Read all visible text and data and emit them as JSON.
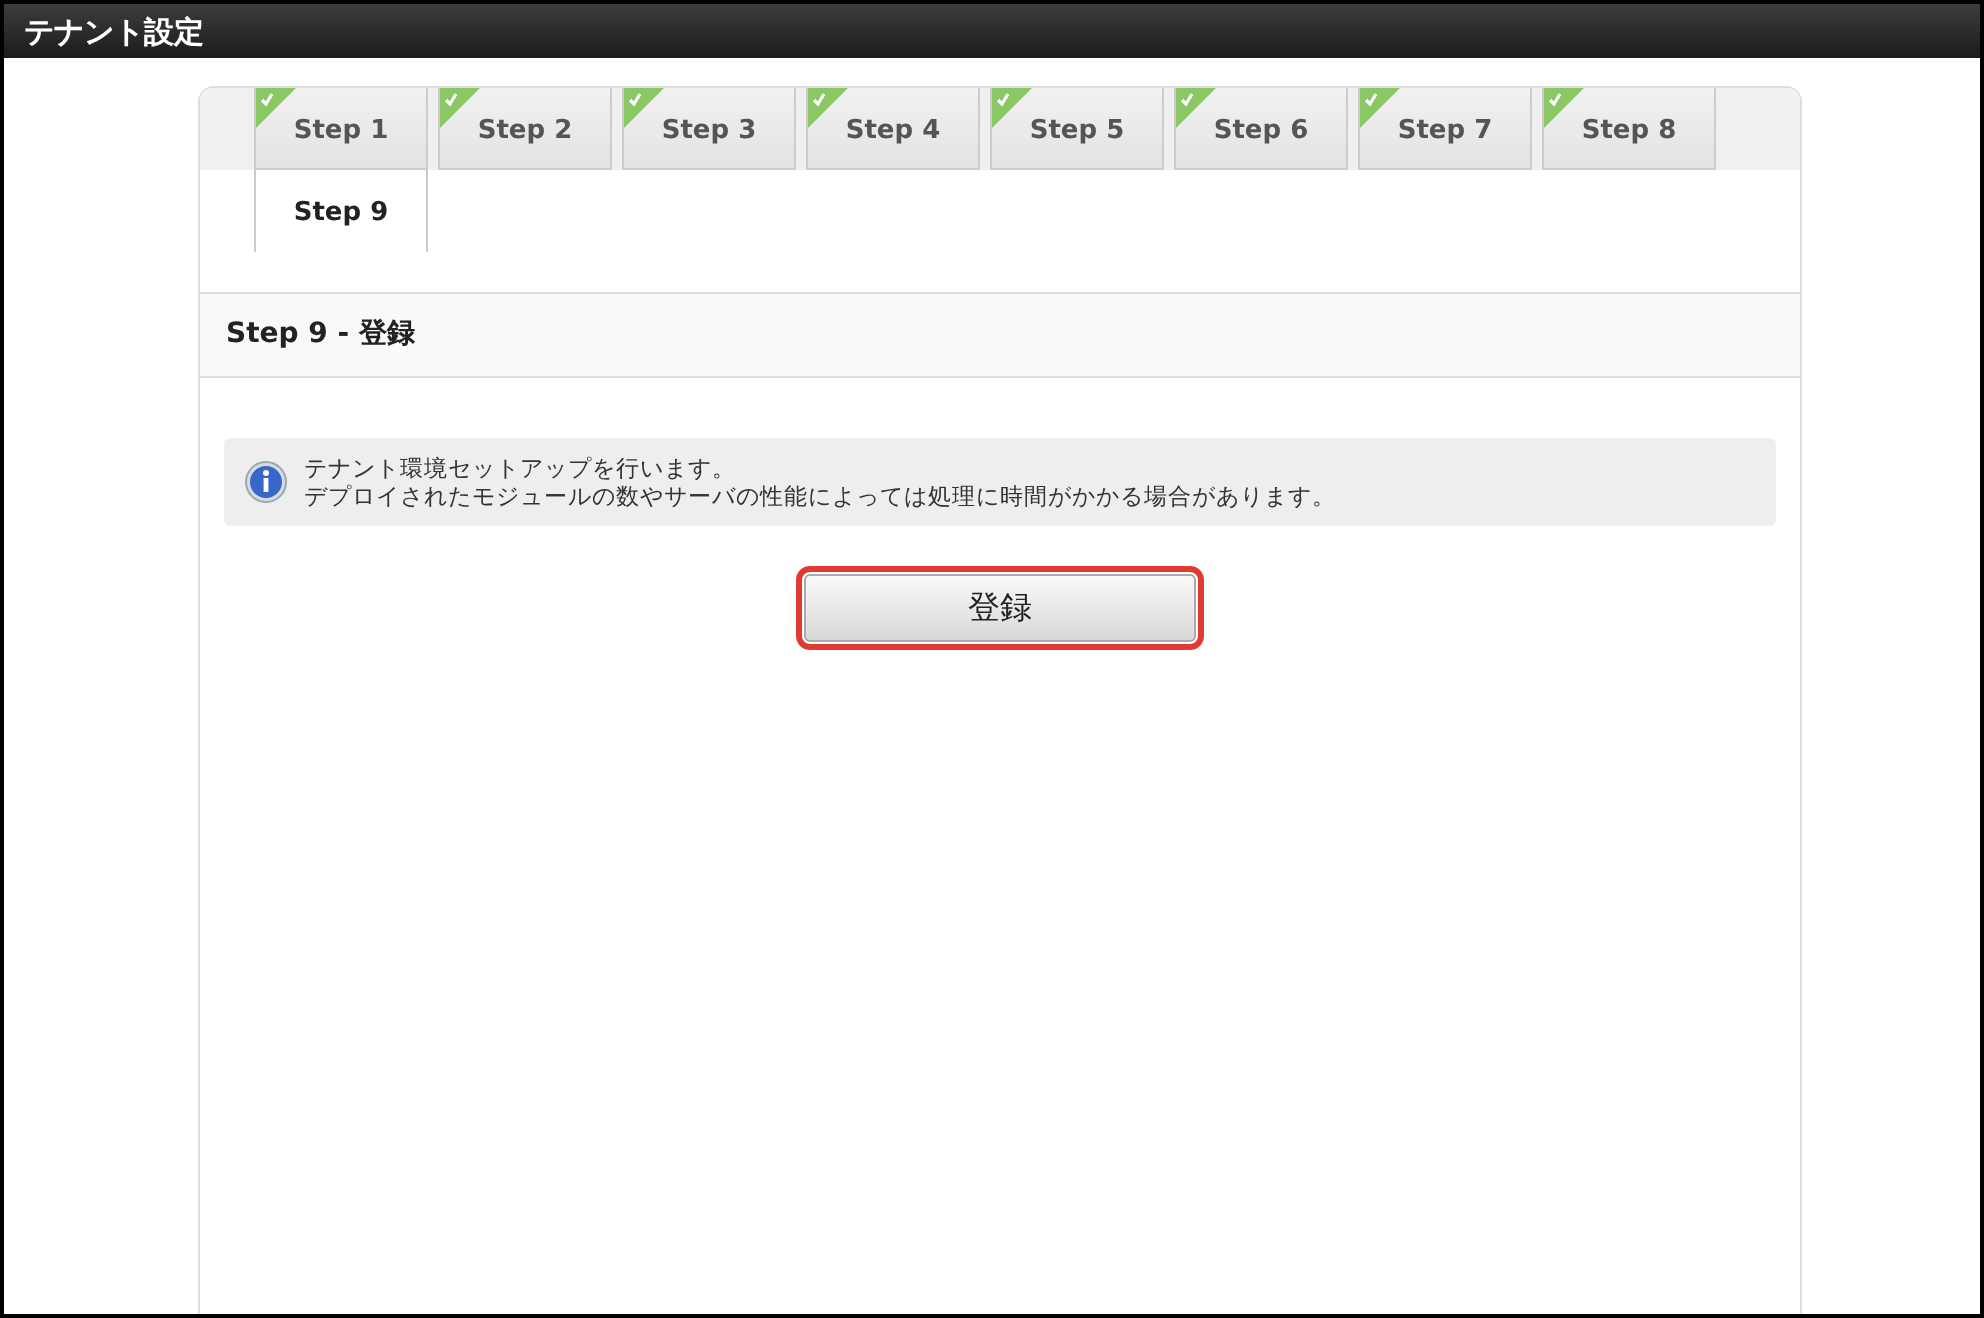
{
  "window": {
    "title": "テナント設定"
  },
  "steps": [
    {
      "label": "Step 1",
      "done": true,
      "selected": false
    },
    {
      "label": "Step 2",
      "done": true,
      "selected": false
    },
    {
      "label": "Step 3",
      "done": true,
      "selected": false
    },
    {
      "label": "Step 4",
      "done": true,
      "selected": false
    },
    {
      "label": "Step 5",
      "done": true,
      "selected": false
    },
    {
      "label": "Step 6",
      "done": true,
      "selected": false
    },
    {
      "label": "Step 7",
      "done": true,
      "selected": false
    },
    {
      "label": "Step 8",
      "done": true,
      "selected": false
    },
    {
      "label": "Step 9",
      "done": false,
      "selected": true
    }
  ],
  "section": {
    "title": "Step 9 - 登録"
  },
  "info": {
    "lines": [
      "テナント環境セットアップを行います。",
      "デプロイされたモジュールの数やサーバの性能によっては処理に時間がかかる場合があります。"
    ]
  },
  "submit": {
    "label": "登録",
    "highlighted": true
  }
}
